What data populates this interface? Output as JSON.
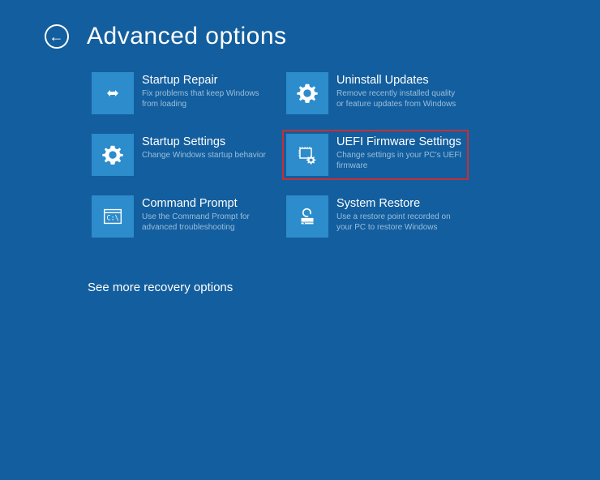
{
  "page": {
    "title": "Advanced options",
    "more_options": "See more recovery options"
  },
  "tiles": {
    "startup_repair": {
      "title": "Startup Repair",
      "desc": "Fix problems that keep Windows from loading"
    },
    "uninstall_updates": {
      "title": "Uninstall Updates",
      "desc": "Remove recently installed quality or feature updates from Windows"
    },
    "startup_settings": {
      "title": "Startup Settings",
      "desc": "Change Windows startup behavior"
    },
    "uefi": {
      "title": "UEFI Firmware Settings",
      "desc": "Change settings in your PC's UEFI firmware"
    },
    "command_prompt": {
      "title": "Command Prompt",
      "desc": "Use the Command Prompt for advanced troubleshooting"
    },
    "system_restore": {
      "title": "System Restore",
      "desc": "Use a restore point recorded on your PC to restore Windows"
    }
  },
  "colors": {
    "background": "#135e9e",
    "tile": "#2d8ccb",
    "highlight": "#c62f33",
    "desc_text": "#9abfdc"
  }
}
